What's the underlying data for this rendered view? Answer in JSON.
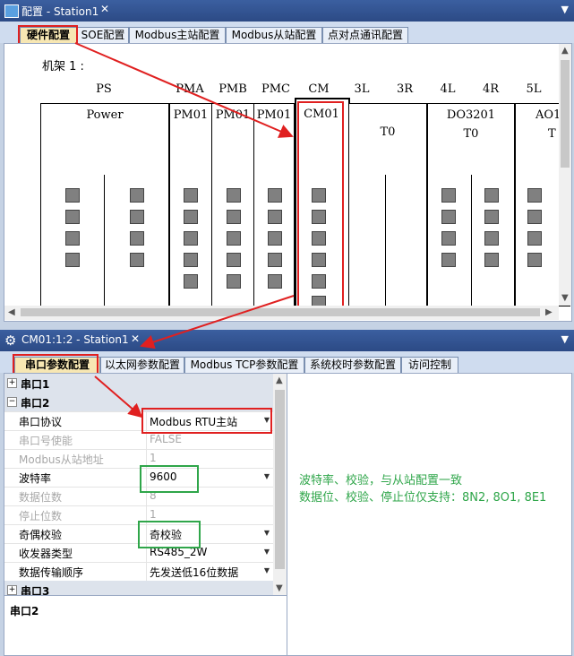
{
  "window1": {
    "title": "配置 - Station1",
    "close": "✕",
    "tabs": [
      "硬件配置",
      "SOE配置",
      "Modbus主站配置",
      "Modbus从站配置",
      "点对点通讯配置"
    ],
    "rack_label": "机架 1 :",
    "slots": [
      "PS",
      "PMA",
      "PMB",
      "PMC",
      "CM",
      "3L",
      "3R",
      "4L",
      "4R",
      "5L"
    ],
    "modules": {
      "power": "Power",
      "pm1": "PM01",
      "pm2": "PM01",
      "pm3": "PM01",
      "cm": "CM01",
      "t0a": "T0",
      "do": "DO3201",
      "t0b": "T0",
      "ao": "AO1",
      "t_partial": "T"
    }
  },
  "window2": {
    "title": "CM01:1:2 - Station1",
    "close": "✕",
    "tabs": [
      "串口参数配置",
      "以太网参数配置",
      "Modbus TCP参数配置",
      "系统校时参数配置",
      "访问控制"
    ],
    "props": [
      {
        "type": "cat",
        "expander": "⊞",
        "label": "串口1"
      },
      {
        "type": "cat",
        "expander": "⊟",
        "label": "串口2"
      },
      {
        "type": "row",
        "label": "串口协议",
        "value": "Modbus RTU主站",
        "dropdown": true
      },
      {
        "type": "dis",
        "label": "串口号使能",
        "value": "FALSE"
      },
      {
        "type": "dis",
        "label": "Modbus从站地址",
        "value": "1"
      },
      {
        "type": "row",
        "label": "波特率",
        "value": "9600",
        "dropdown": true
      },
      {
        "type": "dis",
        "label": "数据位数",
        "value": "8"
      },
      {
        "type": "dis",
        "label": "停止位数",
        "value": "1"
      },
      {
        "type": "row",
        "label": "奇偶校验",
        "value": "奇校验",
        "dropdown": true
      },
      {
        "type": "row",
        "label": "收发器类型",
        "value": "RS485_2W",
        "dropdown": true
      },
      {
        "type": "row",
        "label": "数据传输顺序",
        "value": "先发送低16位数据",
        "dropdown": true
      },
      {
        "type": "cat",
        "expander": "⊞",
        "label": "串口3"
      }
    ],
    "description_title": "串口2",
    "notes": [
      "波特率、校验，与从站配置一致",
      "数据位、校验、停止位仅支持：8N2, 8O1, 8E1"
    ]
  },
  "colors": {
    "annotation_red": "#e02020",
    "annotation_green": "#2fa64a",
    "title_bar": "#2c4a85"
  }
}
